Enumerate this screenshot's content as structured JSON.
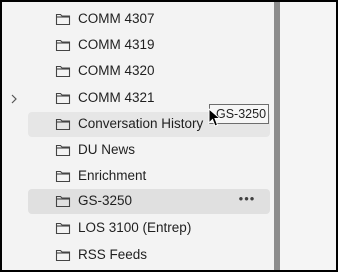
{
  "folders": [
    {
      "label": "COMM 4307",
      "state": "normal",
      "chevron": false,
      "icon": "folder-icon"
    },
    {
      "label": "COMM 4319",
      "state": "normal",
      "chevron": false,
      "icon": "folder-icon"
    },
    {
      "label": "COMM 4320",
      "state": "normal",
      "chevron": false,
      "icon": "folder-icon"
    },
    {
      "label": "COMM 4321",
      "state": "normal",
      "chevron": true,
      "icon": "folder-icon"
    },
    {
      "label": "Conversation History",
      "state": "hover",
      "chevron": false,
      "icon": "folder-icon"
    },
    {
      "label": "DU News",
      "state": "normal",
      "chevron": false,
      "icon": "folder-icon"
    },
    {
      "label": "Enrichment",
      "state": "normal",
      "chevron": false,
      "icon": "folder-icon"
    },
    {
      "label": "GS-3250",
      "state": "selected",
      "chevron": false,
      "icon": "folder-icon",
      "more": "•••"
    },
    {
      "label": "LOS 3100 (Entrep)",
      "state": "normal",
      "chevron": false,
      "icon": "folder-icon"
    },
    {
      "label": "RSS Feeds",
      "state": "normal",
      "chevron": false,
      "icon": "folder-icon"
    }
  ],
  "drag_tooltip": {
    "label": "GS-3250"
  },
  "colors": {
    "pane_bg": "#f3f3f3",
    "hover_bg": "#e6e6e6",
    "selected_bg": "#e0e0e0",
    "splitter": "#8c8c8c"
  }
}
